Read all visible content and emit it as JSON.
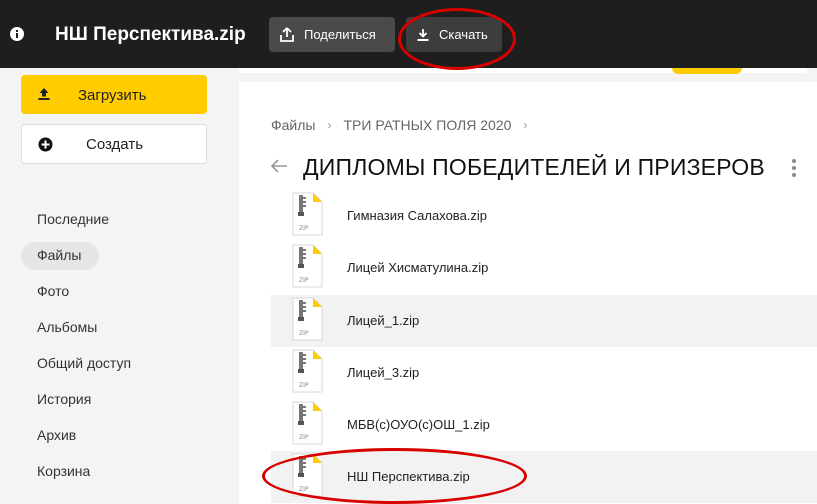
{
  "header": {
    "title": "НШ Перспектива.zip",
    "share_label": "Поделиться",
    "download_label": "Скачать"
  },
  "sidebar": {
    "upload_label": "Загрузить",
    "create_label": "Создать",
    "items": [
      {
        "label": "Последние"
      },
      {
        "label": "Файлы",
        "active": true
      },
      {
        "label": "Фото"
      },
      {
        "label": "Альбомы"
      },
      {
        "label": "Общий доступ"
      },
      {
        "label": "История"
      },
      {
        "label": "Архив"
      },
      {
        "label": "Корзина"
      }
    ]
  },
  "breadcrumb": [
    "Файлы",
    "ТРИ РАТНЫХ ПОЛЯ 2020"
  ],
  "folder_title": "ДИПЛОМЫ ПОБЕДИТЕЛЕЙ И ПРИЗЕРОВ",
  "files": [
    {
      "name": "Гимназия Салахова.zip",
      "icon_label": "ZIP"
    },
    {
      "name": "Лицей Хисматулина.zip",
      "icon_label": "ZIP"
    },
    {
      "name": "Лицей_1.zip",
      "icon_label": "ZIP"
    },
    {
      "name": "Лицей_3.zip",
      "icon_label": "ZIP"
    },
    {
      "name": "МБВ(с)ОУО(с)ОШ_1.zip",
      "icon_label": "ZIP"
    },
    {
      "name": "НШ Перспектива.zip",
      "icon_label": "ZIP"
    }
  ],
  "colors": {
    "topbar": "#1e1e1e",
    "accent_yellow": "#ffcc00",
    "annotation_red": "#d90000"
  }
}
